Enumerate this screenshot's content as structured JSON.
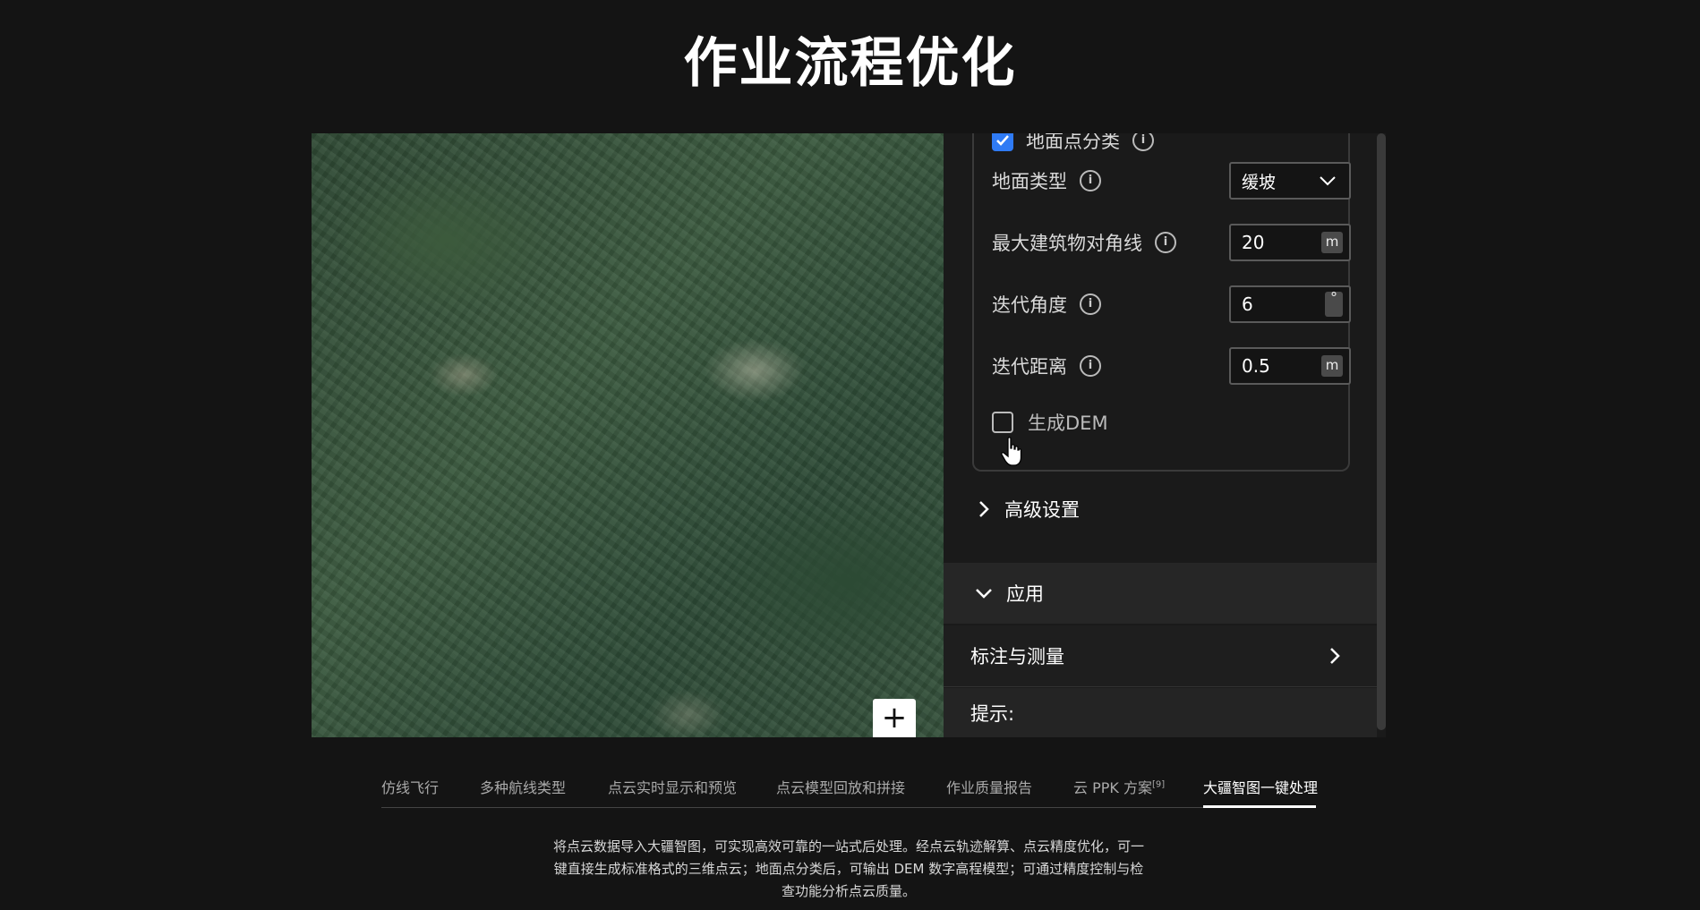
{
  "page_title": "作业流程优化",
  "map": {
    "zoom_in_label": "+"
  },
  "panel": {
    "ground_classify": {
      "label": "地面点分类",
      "checked": true
    },
    "ground_type": {
      "label": "地面类型",
      "value": "缓坡"
    },
    "max_building_diagonal": {
      "label": "最大建筑物对角线",
      "value": "20",
      "unit": "m"
    },
    "iteration_angle": {
      "label": "迭代角度",
      "value": "6",
      "unit": "°"
    },
    "iteration_distance": {
      "label": "迭代距离",
      "value": "0.5",
      "unit": "m"
    },
    "generate_dem": {
      "label": "生成DEM",
      "checked": false
    },
    "advanced_settings": "高级设置",
    "apply": "应用",
    "annotate_measure": "标注与测量",
    "hint": "提示:"
  },
  "tabs": [
    {
      "label": "仿线飞行"
    },
    {
      "label": "多种航线类型"
    },
    {
      "label": "点云实时显示和预览"
    },
    {
      "label": "点云模型回放和拼接"
    },
    {
      "label": "作业质量报告"
    },
    {
      "label": "云 PPK 方案",
      "sup": "[9]"
    },
    {
      "label": "大疆智图一键处理",
      "active": true
    }
  ],
  "description": [
    "将点云数据导入大疆智图，可实现高效可靠的一站式后处理。经点云轨迹解算、点云精度优化，可一",
    "键直接生成标准格式的三维点云；地面点分类后，可输出 DEM 数字高程模型；可通过精度控制与检",
    "查功能分析点云质量。"
  ],
  "colors": {
    "accent": "#2f7bf5",
    "background": "#141414",
    "panel": "#1a1a1a"
  }
}
